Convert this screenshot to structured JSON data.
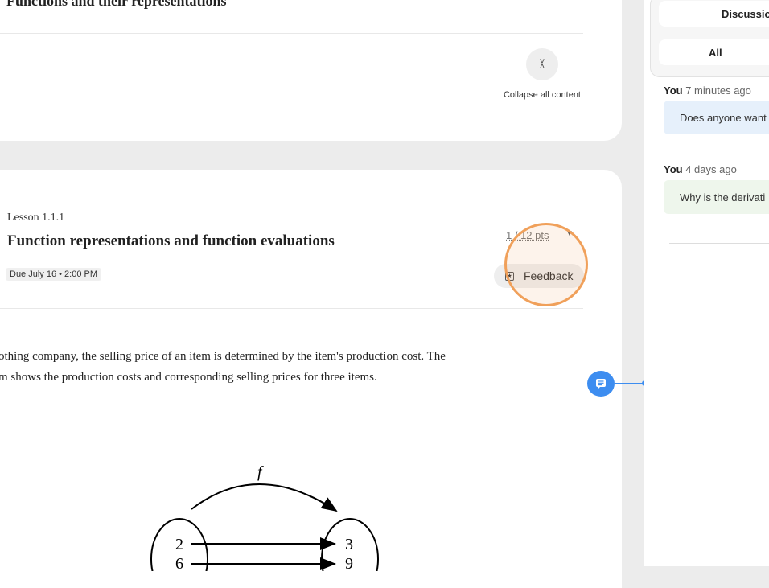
{
  "top_section": {
    "title": "Functions and their representations",
    "collapse_label": "Collapse all content"
  },
  "lesson": {
    "number": "Lesson 1.1.1",
    "title": "Function representations and function evaluations",
    "due": "Due July 16 • 2:00 PM",
    "points": "1 / 12 pts",
    "feedback_label": "Feedback"
  },
  "problem": {
    "line1": "othing company, the selling price of an item is determined by the item's production cost. The",
    "line2": "m shows the production costs and corresponding selling prices for three items."
  },
  "diagram": {
    "function_label": "f",
    "domain_values": [
      "2",
      "6"
    ],
    "range_values": [
      "3",
      "9"
    ]
  },
  "discussion_panel": {
    "tab_discussion": "Discussion",
    "tab_all": "All",
    "messages": [
      {
        "author": "You",
        "time": "7 minutes ago",
        "text": "Does anyone want"
      },
      {
        "author": "You",
        "time": "4 days ago",
        "text": "Why is the derivati"
      }
    ]
  },
  "colors": {
    "accent_blue": "#3d8df0",
    "highlight_orange": "#f0a05a"
  }
}
